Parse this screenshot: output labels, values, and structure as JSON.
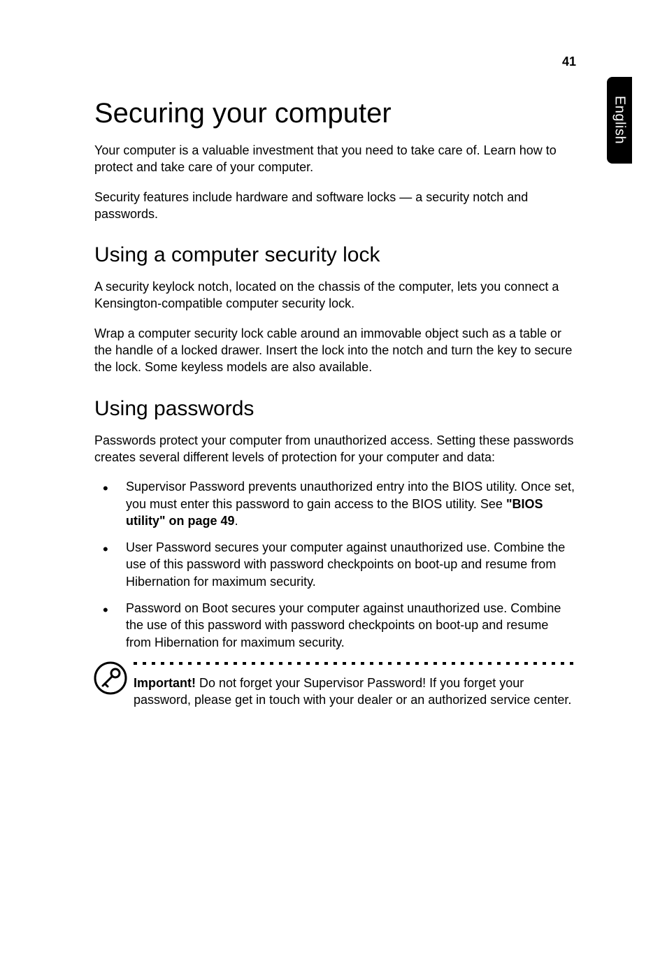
{
  "page_number": "41",
  "side_tab_label": "English",
  "main_title": "Securing your computer",
  "intro_para_1": "Your computer is a valuable investment that you need to take care of. Learn how to protect and take care of your computer.",
  "intro_para_2": "Security features include hardware and software locks — a security notch and passwords.",
  "section1_title": "Using a computer security lock",
  "section1_para_1": "A security keylock notch, located on the chassis of the computer, lets you connect a Kensington-compatible computer security lock.",
  "section1_para_2": "Wrap a computer security lock cable around an immovable object such as a table or the handle of a locked drawer. Insert the lock into the notch and turn the key to secure the lock. Some keyless models are also available.",
  "section2_title": "Using passwords",
  "section2_intro": "Passwords protect your computer from unauthorized access. Setting these passwords creates several different levels of protection for your computer and data:",
  "bullets": [
    {
      "text_before_link": "Supervisor Password prevents unauthorized entry into the BIOS utility. Once set, you must enter this password to gain access to the BIOS utility. See ",
      "link_text": "\"BIOS utility\" on page 49",
      "text_after_link": "."
    },
    {
      "text": "User Password secures your computer against unauthorized use. Combine the use of this password with password checkpoints on boot-up and resume from Hibernation for maximum security."
    },
    {
      "text": "Password on Boot secures your computer against unauthorized use. Combine the use of this password with password checkpoints on boot-up and resume from Hibernation for maximum security."
    }
  ],
  "callout": {
    "important_label": "Important!",
    "text": " Do not forget your Supervisor Password! If you forget your password, please get in touch with your dealer or an authorized service center."
  }
}
